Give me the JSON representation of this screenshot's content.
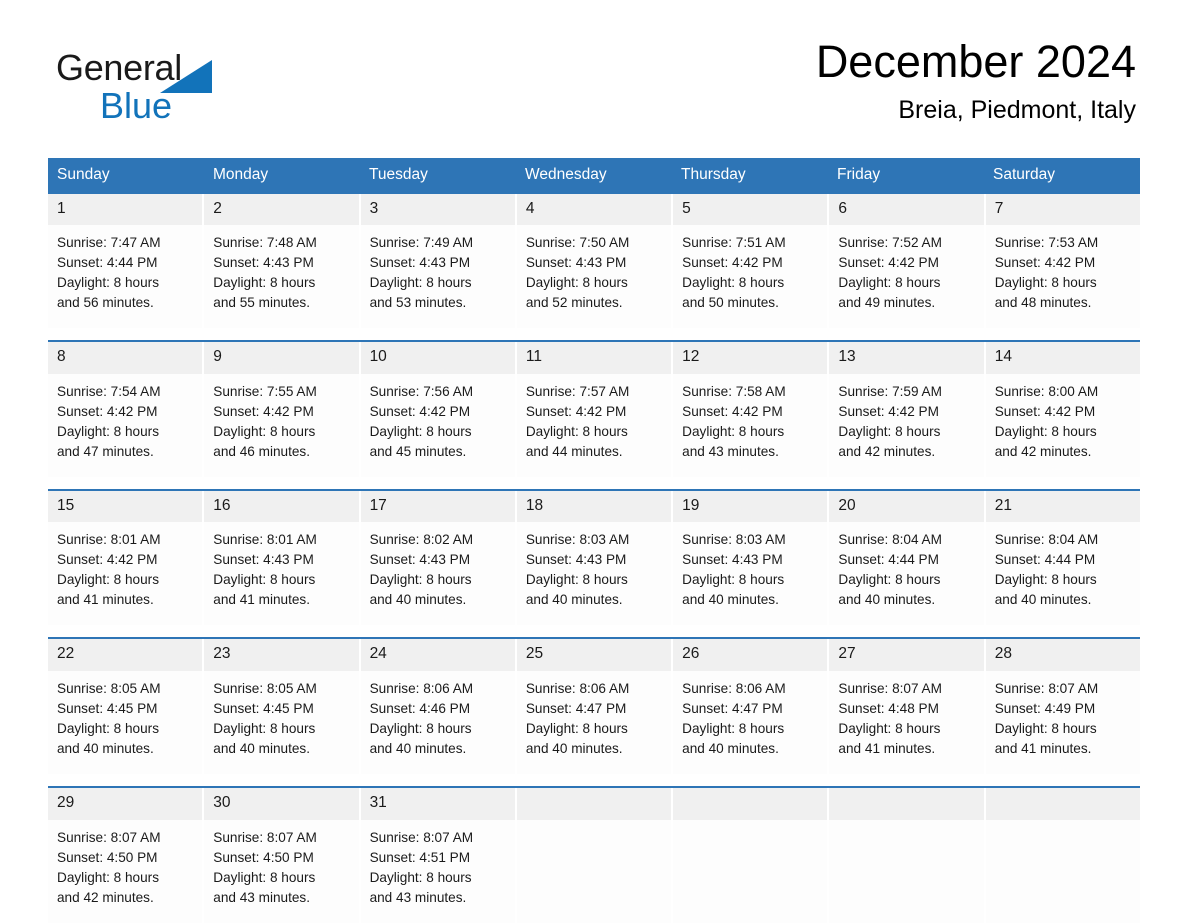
{
  "brand": {
    "name_part1": "General",
    "name_part2": "Blue",
    "triangle_icon": "triangle-icon",
    "accent_color": "#1273ba"
  },
  "header": {
    "title": "December 2024",
    "subtitle": "Breia, Piedmont, Italy"
  },
  "theme": {
    "header_blue": "#2e75b6",
    "daynum_gray": "#f0f0f0",
    "cell_white": "#fdfdfd"
  },
  "weekdays": [
    "Sunday",
    "Monday",
    "Tuesday",
    "Wednesday",
    "Thursday",
    "Friday",
    "Saturday"
  ],
  "weeks": [
    {
      "days": [
        {
          "num": "1",
          "sunrise": "Sunrise: 7:47 AM",
          "sunset": "Sunset: 4:44 PM",
          "daylight_line1": "Daylight: 8 hours",
          "daylight_line2": "and 56 minutes."
        },
        {
          "num": "2",
          "sunrise": "Sunrise: 7:48 AM",
          "sunset": "Sunset: 4:43 PM",
          "daylight_line1": "Daylight: 8 hours",
          "daylight_line2": "and 55 minutes."
        },
        {
          "num": "3",
          "sunrise": "Sunrise: 7:49 AM",
          "sunset": "Sunset: 4:43 PM",
          "daylight_line1": "Daylight: 8 hours",
          "daylight_line2": "and 53 minutes."
        },
        {
          "num": "4",
          "sunrise": "Sunrise: 7:50 AM",
          "sunset": "Sunset: 4:43 PM",
          "daylight_line1": "Daylight: 8 hours",
          "daylight_line2": "and 52 minutes."
        },
        {
          "num": "5",
          "sunrise": "Sunrise: 7:51 AM",
          "sunset": "Sunset: 4:42 PM",
          "daylight_line1": "Daylight: 8 hours",
          "daylight_line2": "and 50 minutes."
        },
        {
          "num": "6",
          "sunrise": "Sunrise: 7:52 AM",
          "sunset": "Sunset: 4:42 PM",
          "daylight_line1": "Daylight: 8 hours",
          "daylight_line2": "and 49 minutes."
        },
        {
          "num": "7",
          "sunrise": "Sunrise: 7:53 AM",
          "sunset": "Sunset: 4:42 PM",
          "daylight_line1": "Daylight: 8 hours",
          "daylight_line2": "and 48 minutes."
        }
      ]
    },
    {
      "days": [
        {
          "num": "8",
          "sunrise": "Sunrise: 7:54 AM",
          "sunset": "Sunset: 4:42 PM",
          "daylight_line1": "Daylight: 8 hours",
          "daylight_line2": "and 47 minutes."
        },
        {
          "num": "9",
          "sunrise": "Sunrise: 7:55 AM",
          "sunset": "Sunset: 4:42 PM",
          "daylight_line1": "Daylight: 8 hours",
          "daylight_line2": "and 46 minutes."
        },
        {
          "num": "10",
          "sunrise": "Sunrise: 7:56 AM",
          "sunset": "Sunset: 4:42 PM",
          "daylight_line1": "Daylight: 8 hours",
          "daylight_line2": "and 45 minutes."
        },
        {
          "num": "11",
          "sunrise": "Sunrise: 7:57 AM",
          "sunset": "Sunset: 4:42 PM",
          "daylight_line1": "Daylight: 8 hours",
          "daylight_line2": "and 44 minutes."
        },
        {
          "num": "12",
          "sunrise": "Sunrise: 7:58 AM",
          "sunset": "Sunset: 4:42 PM",
          "daylight_line1": "Daylight: 8 hours",
          "daylight_line2": "and 43 minutes."
        },
        {
          "num": "13",
          "sunrise": "Sunrise: 7:59 AM",
          "sunset": "Sunset: 4:42 PM",
          "daylight_line1": "Daylight: 8 hours",
          "daylight_line2": "and 42 minutes."
        },
        {
          "num": "14",
          "sunrise": "Sunrise: 8:00 AM",
          "sunset": "Sunset: 4:42 PM",
          "daylight_line1": "Daylight: 8 hours",
          "daylight_line2": "and 42 minutes."
        }
      ]
    },
    {
      "days": [
        {
          "num": "15",
          "sunrise": "Sunrise: 8:01 AM",
          "sunset": "Sunset: 4:42 PM",
          "daylight_line1": "Daylight: 8 hours",
          "daylight_line2": "and 41 minutes."
        },
        {
          "num": "16",
          "sunrise": "Sunrise: 8:01 AM",
          "sunset": "Sunset: 4:43 PM",
          "daylight_line1": "Daylight: 8 hours",
          "daylight_line2": "and 41 minutes."
        },
        {
          "num": "17",
          "sunrise": "Sunrise: 8:02 AM",
          "sunset": "Sunset: 4:43 PM",
          "daylight_line1": "Daylight: 8 hours",
          "daylight_line2": "and 40 minutes."
        },
        {
          "num": "18",
          "sunrise": "Sunrise: 8:03 AM",
          "sunset": "Sunset: 4:43 PM",
          "daylight_line1": "Daylight: 8 hours",
          "daylight_line2": "and 40 minutes."
        },
        {
          "num": "19",
          "sunrise": "Sunrise: 8:03 AM",
          "sunset": "Sunset: 4:43 PM",
          "daylight_line1": "Daylight: 8 hours",
          "daylight_line2": "and 40 minutes."
        },
        {
          "num": "20",
          "sunrise": "Sunrise: 8:04 AM",
          "sunset": "Sunset: 4:44 PM",
          "daylight_line1": "Daylight: 8 hours",
          "daylight_line2": "and 40 minutes."
        },
        {
          "num": "21",
          "sunrise": "Sunrise: 8:04 AM",
          "sunset": "Sunset: 4:44 PM",
          "daylight_line1": "Daylight: 8 hours",
          "daylight_line2": "and 40 minutes."
        }
      ]
    },
    {
      "days": [
        {
          "num": "22",
          "sunrise": "Sunrise: 8:05 AM",
          "sunset": "Sunset: 4:45 PM",
          "daylight_line1": "Daylight: 8 hours",
          "daylight_line2": "and 40 minutes."
        },
        {
          "num": "23",
          "sunrise": "Sunrise: 8:05 AM",
          "sunset": "Sunset: 4:45 PM",
          "daylight_line1": "Daylight: 8 hours",
          "daylight_line2": "and 40 minutes."
        },
        {
          "num": "24",
          "sunrise": "Sunrise: 8:06 AM",
          "sunset": "Sunset: 4:46 PM",
          "daylight_line1": "Daylight: 8 hours",
          "daylight_line2": "and 40 minutes."
        },
        {
          "num": "25",
          "sunrise": "Sunrise: 8:06 AM",
          "sunset": "Sunset: 4:47 PM",
          "daylight_line1": "Daylight: 8 hours",
          "daylight_line2": "and 40 minutes."
        },
        {
          "num": "26",
          "sunrise": "Sunrise: 8:06 AM",
          "sunset": "Sunset: 4:47 PM",
          "daylight_line1": "Daylight: 8 hours",
          "daylight_line2": "and 40 minutes."
        },
        {
          "num": "27",
          "sunrise": "Sunrise: 8:07 AM",
          "sunset": "Sunset: 4:48 PM",
          "daylight_line1": "Daylight: 8 hours",
          "daylight_line2": "and 41 minutes."
        },
        {
          "num": "28",
          "sunrise": "Sunrise: 8:07 AM",
          "sunset": "Sunset: 4:49 PM",
          "daylight_line1": "Daylight: 8 hours",
          "daylight_line2": "and 41 minutes."
        }
      ]
    },
    {
      "days": [
        {
          "num": "29",
          "sunrise": "Sunrise: 8:07 AM",
          "sunset": "Sunset: 4:50 PM",
          "daylight_line1": "Daylight: 8 hours",
          "daylight_line2": "and 42 minutes."
        },
        {
          "num": "30",
          "sunrise": "Sunrise: 8:07 AM",
          "sunset": "Sunset: 4:50 PM",
          "daylight_line1": "Daylight: 8 hours",
          "daylight_line2": "and 43 minutes."
        },
        {
          "num": "31",
          "sunrise": "Sunrise: 8:07 AM",
          "sunset": "Sunset: 4:51 PM",
          "daylight_line1": "Daylight: 8 hours",
          "daylight_line2": "and 43 minutes."
        },
        {
          "num": "",
          "sunrise": "",
          "sunset": "",
          "daylight_line1": "",
          "daylight_line2": ""
        },
        {
          "num": "",
          "sunrise": "",
          "sunset": "",
          "daylight_line1": "",
          "daylight_line2": ""
        },
        {
          "num": "",
          "sunrise": "",
          "sunset": "",
          "daylight_line1": "",
          "daylight_line2": ""
        },
        {
          "num": "",
          "sunrise": "",
          "sunset": "",
          "daylight_line1": "",
          "daylight_line2": ""
        }
      ]
    }
  ]
}
